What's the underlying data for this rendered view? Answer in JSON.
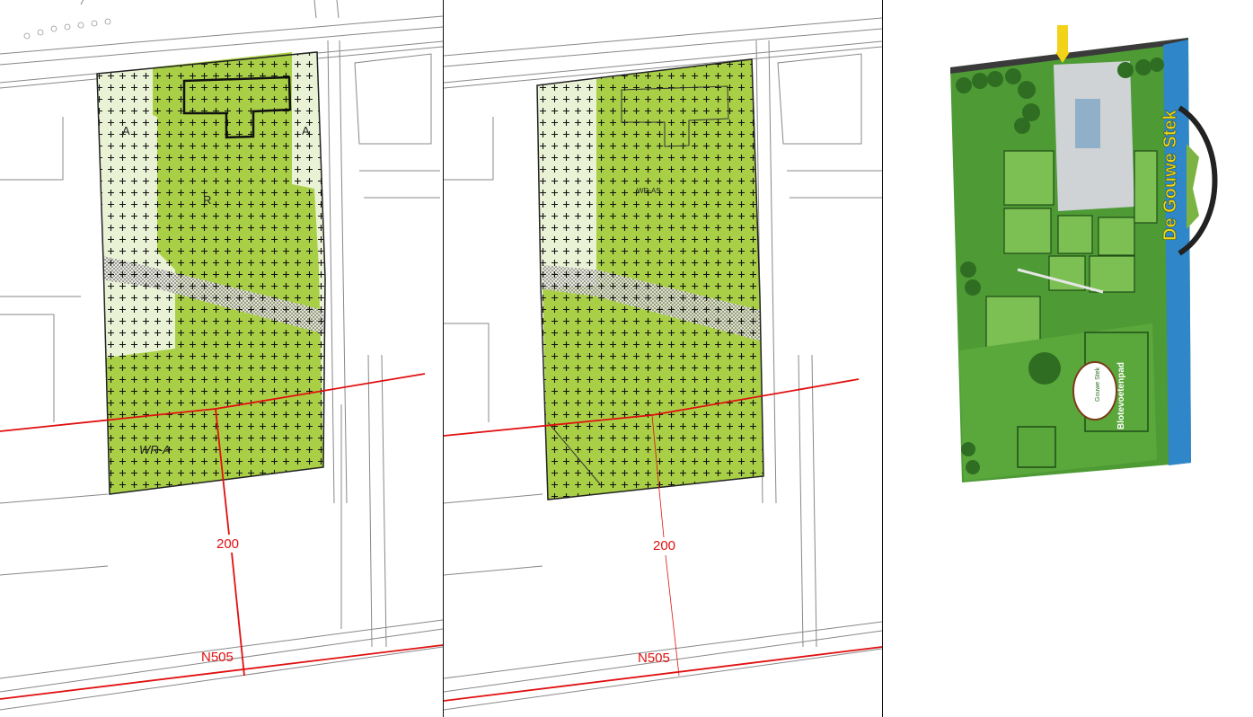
{
  "maps": {
    "left": {
      "zone_labels": [
        "A",
        "A",
        "R",
        "WR-A"
      ],
      "distance_label": "200",
      "road_label": "N505"
    },
    "middle": {
      "zone_labels": [
        "WR-AS"
      ],
      "distance_label": "200",
      "road_label": "N505"
    },
    "right": {
      "title": "De Gouwe Stek",
      "path_label": "Blotevoetenpad",
      "logo_text": "Gouwe Stek",
      "colors": {
        "water": "#2f86c8",
        "grass": "#4e9a35",
        "grass_light": "#7cc054",
        "title_yellow": "#f3d21a"
      }
    }
  },
  "colors": {
    "zone_green": "#a8cf45",
    "zone_light": "#eaf2d6",
    "contour_red": "#e01010"
  }
}
